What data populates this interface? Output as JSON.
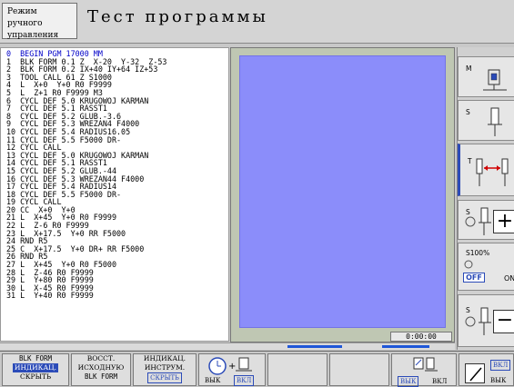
{
  "header": {
    "mode_line1": "Режим ручного",
    "mode_line2": "управления",
    "title": "Тест программы"
  },
  "program_lines": [
    "0  BEGIN PGM 17000 MM",
    "1  BLK FORM 0.1 Z  X-20  Y-32  Z-53",
    "2  BLK FORM 0.2 IX+40 IY+64 IZ+53",
    "3  TOOL CALL 61 Z S1000",
    "4  L  X+0  Y+0 R0 F9999",
    "5  L  Z+1 R0 F9999 M3",
    "6  CYCL DEF 5.0 KRUGOWOJ KARMAN",
    "7  CYCL DEF 5.1 RASST1",
    "8  CYCL DEF 5.2 GLUB.-3.6",
    "9  CYCL DEF 5.3 WREZAN4 F4000",
    "10 CYCL DEF 5.4 RADIUS16.05",
    "11 CYCL DEF 5.5 F5000 DR-",
    "12 CYCL CALL",
    "13 CYCL DEF 5.0 KRUGOWOJ KARMAN",
    "14 CYCL DEF 5.1 RASST1",
    "15 CYCL DEF 5.2 GLUB.-44",
    "16 CYCL DEF 5.3 WREZAN44 F4000",
    "17 CYCL DEF 5.4 RADIUS14",
    "18 CYCL DEF 5.5 F5000 DR-",
    "19 CYCL CALL",
    "20 CC  X+0  Y+0",
    "21 L  X+45  Y+0 R0 F9999",
    "22 L  Z-6 R0 F9999",
    "23 L  X+17.5  Y+0 RR F5000",
    "24 RND R5",
    "25 C  X+17.5  Y+0 DR+ RR F5000",
    "26 RND R5",
    "27 L  X+45  Y+0 R0 F5000",
    "28 L  Z-46 R0 F9999",
    "29 L  Y+80 R0 F9999",
    "30 L  X-45 R0 F9999",
    "31 L  Y+40 R0 F9999"
  ],
  "graphics": {
    "time": "0:00:00"
  },
  "right_softkeys": {
    "m_label": "M",
    "s_label": "S",
    "t_label": "T",
    "s_plus": "S",
    "s100": "S100%",
    "off": "OFF",
    "on": "ON",
    "s_minus": "S"
  },
  "bottom_softkeys": {
    "blk_form": "BLK FORM",
    "indikac": "ИНДИКАЦ.",
    "skryt": "СКРЫТЬ",
    "vosst": "ВОССТ.",
    "ishodnuyu": "ИСХОДНУЮ",
    "blk_form2": "BLK FORM",
    "indikac2": "ИНДИКАЦ.",
    "instrum": "ИНСТРУМ.",
    "skryt2": "СКРЫТЬ",
    "vyk": "ВЫК",
    "vkl": "ВКЛ",
    "vyk2": "ВЫК",
    "vkl2": "ВКЛ",
    "vkl3": "ВКЛ",
    "vyk3": "ВЫК"
  }
}
